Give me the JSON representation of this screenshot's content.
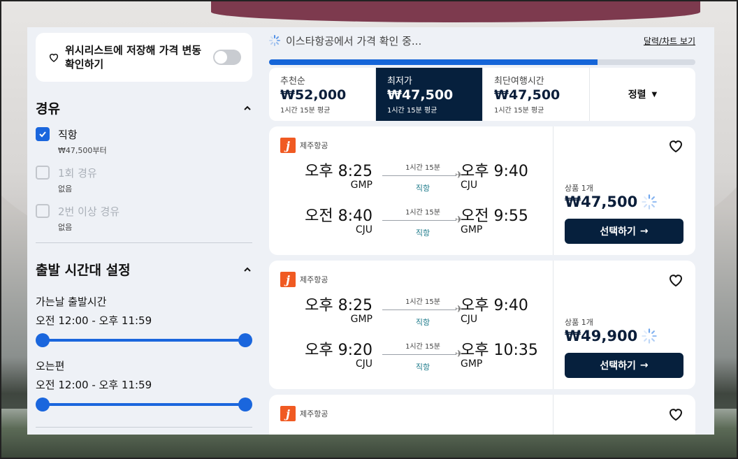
{
  "sidebar": {
    "wishlist_text": "위시리스트에 저장해 가격 변동 확인하기",
    "stops": {
      "title": "경유",
      "options": [
        {
          "label": "직항",
          "sub": "₩47,500부터",
          "checked": true
        },
        {
          "label": "1회 경유",
          "sub": "없음",
          "checked": false
        },
        {
          "label": "2번 이상 경유",
          "sub": "없음",
          "checked": false
        }
      ]
    },
    "departure_times": {
      "title": "출발 시간대 설정",
      "outbound_label": "가는날 출발시간",
      "outbound_range": "오전 12:00 - 오후 11:59",
      "return_label": "오는편",
      "return_range": "오전 12:00 - 오후 11:59"
    }
  },
  "main": {
    "status": "이스타항공에서 가격 확인 중...",
    "view_link": "달력/차트 보기",
    "progress_fraction": 0.77,
    "sort_tabs": [
      {
        "label": "추천순",
        "price": "₩52,000",
        "avg": "1시간 15분 평균",
        "active": false
      },
      {
        "label": "최저가",
        "price": "₩47,500",
        "avg": "1시간 15분 평균",
        "active": true
      },
      {
        "label": "최단여행시간",
        "price": "₩47,500",
        "avg": "1시간 15분 평균",
        "active": false
      }
    ],
    "sort_dropdown": "정렬",
    "results": [
      {
        "airline": "제주항공",
        "logo_letter": "j",
        "legs": [
          {
            "dep_time": "오후 8:25",
            "dep_code": "GMP",
            "duration": "1시간 15분",
            "stops": "직항",
            "arr_time": "오후 9:40",
            "arr_code": "CJU"
          },
          {
            "dep_time": "오전 8:40",
            "dep_code": "CJU",
            "duration": "1시간 15분",
            "stops": "직항",
            "arr_time": "오전 9:55",
            "arr_code": "GMP"
          }
        ],
        "offers": "상품 1개",
        "price": "₩47,500",
        "select_label": "선택하기"
      },
      {
        "airline": "제주항공",
        "logo_letter": "j",
        "legs": [
          {
            "dep_time": "오후 8:25",
            "dep_code": "GMP",
            "duration": "1시간 15분",
            "stops": "직항",
            "arr_time": "오후 9:40",
            "arr_code": "CJU"
          },
          {
            "dep_time": "오후 9:20",
            "dep_code": "CJU",
            "duration": "1시간 15분",
            "stops": "직항",
            "arr_time": "오후 10:35",
            "arr_code": "GMP"
          }
        ],
        "offers": "상품 1개",
        "price": "₩49,900",
        "select_label": "선택하기"
      },
      {
        "airline": "제주항공",
        "logo_letter": "j"
      }
    ]
  },
  "colors": {
    "accent": "#1a66dd",
    "dark_navy": "#06203d",
    "airline_orange": "#f05a22",
    "direct_teal": "#1c7a8a"
  },
  "icons": [
    "heart-icon",
    "chevron-up-icon",
    "check-icon",
    "spinner-icon",
    "plane-icon",
    "arrow-right-icon",
    "caret-down-icon"
  ]
}
